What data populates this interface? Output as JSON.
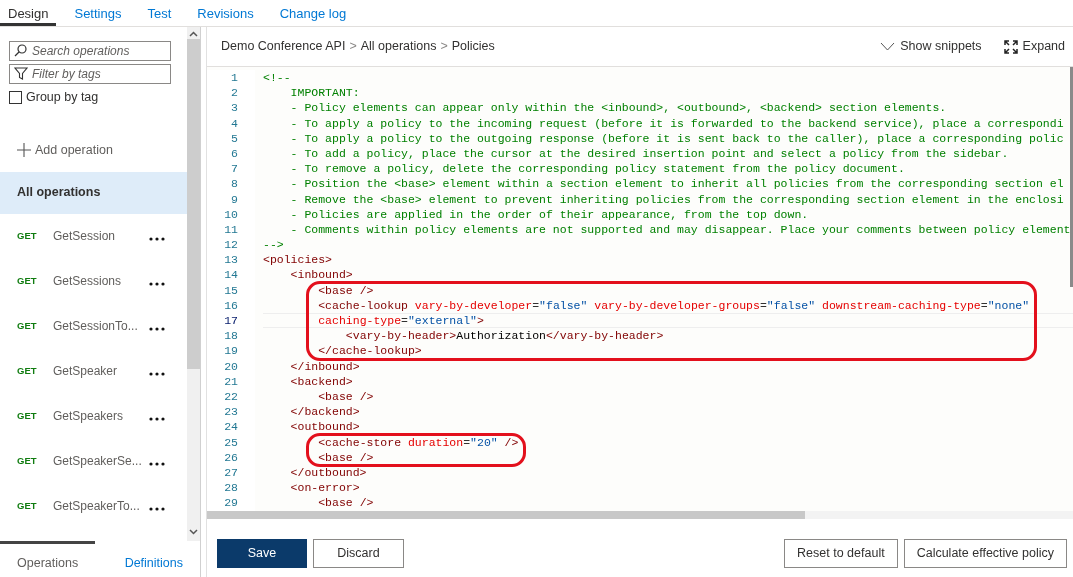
{
  "tabs": [
    {
      "label": "Design",
      "selected": true
    },
    {
      "label": "Settings",
      "selected": false
    },
    {
      "label": "Test",
      "selected": false
    },
    {
      "label": "Revisions",
      "selected": false
    },
    {
      "label": "Change log",
      "selected": false
    }
  ],
  "sidebar": {
    "search": {
      "placeholder": "Search operations"
    },
    "filter": {
      "placeholder": "Filter by tags"
    },
    "group_by_tag": {
      "label": "Group by tag",
      "checked": false
    },
    "add_operation": "Add operation",
    "all_operations": {
      "label": "All operations",
      "selected": true
    },
    "operations": [
      {
        "method": "GET",
        "name": "GetSession",
        "selected": false
      },
      {
        "method": "GET",
        "name": "GetSessions",
        "selected": false
      },
      {
        "method": "GET",
        "name": "GetSessionTo...",
        "selected": false
      },
      {
        "method": "GET",
        "name": "GetSpeaker",
        "selected": false
      },
      {
        "method": "GET",
        "name": "GetSpeakers",
        "selected": false
      },
      {
        "method": "GET",
        "name": "GetSpeakerSe...",
        "selected": false
      },
      {
        "method": "GET",
        "name": "GetSpeakerTo...",
        "selected": false
      }
    ],
    "bottom_tabs": [
      {
        "label": "Operations",
        "selected": true
      },
      {
        "label": "Definitions",
        "selected": false
      }
    ]
  },
  "breadcrumb": [
    {
      "kind": "link",
      "text": "Demo Conference API"
    },
    {
      "kind": "separator",
      "text": ">"
    },
    {
      "kind": "link",
      "text": "All operations"
    },
    {
      "kind": "separator",
      "text": ">"
    },
    {
      "kind": "current",
      "text": "Policies"
    }
  ],
  "toolbar": [
    {
      "kind": "snippets",
      "label": "Show snippets"
    },
    {
      "kind": "expand",
      "label": "Expand"
    }
  ],
  "editor": {
    "lines": [
      {
        "number": "1",
        "current": false,
        "circled": false,
        "tokens": [
          {
            "kind": "comment",
            "text": "<!--"
          }
        ]
      },
      {
        "number": "2",
        "current": false,
        "circled": false,
        "tokens": [
          {
            "kind": "comment",
            "text": "    IMPORTANT:"
          }
        ]
      },
      {
        "number": "3",
        "current": false,
        "circled": false,
        "tokens": [
          {
            "kind": "comment",
            "text": "    - Policy elements can appear only within the <inbound>, <outbound>, <backend> section elements."
          }
        ]
      },
      {
        "number": "4",
        "current": false,
        "circled": false,
        "tokens": [
          {
            "kind": "comment",
            "text": "    - To apply a policy to the incoming request (before it is forwarded to the backend service), place a correspondi"
          }
        ]
      },
      {
        "number": "5",
        "current": false,
        "circled": false,
        "tokens": [
          {
            "kind": "comment",
            "text": "    - To apply a policy to the outgoing response (before it is sent back to the caller), place a corresponding polic"
          }
        ]
      },
      {
        "number": "6",
        "current": false,
        "circled": false,
        "tokens": [
          {
            "kind": "comment",
            "text": "    - To add a policy, place the cursor at the desired insertion point and select a policy from the sidebar."
          }
        ]
      },
      {
        "number": "7",
        "current": false,
        "circled": false,
        "tokens": [
          {
            "kind": "comment",
            "text": "    - To remove a policy, delete the corresponding policy statement from the policy document."
          }
        ]
      },
      {
        "number": "8",
        "current": false,
        "circled": false,
        "tokens": [
          {
            "kind": "comment",
            "text": "    - Position the <base> element within a section element to inherit all policies from the corresponding section el"
          }
        ]
      },
      {
        "number": "9",
        "current": false,
        "circled": false,
        "tokens": [
          {
            "kind": "comment",
            "text": "    - Remove the <base> element to prevent inheriting policies from the corresponding section element in the enclosi"
          }
        ]
      },
      {
        "number": "10",
        "current": false,
        "circled": false,
        "tokens": [
          {
            "kind": "comment",
            "text": "    - Policies are applied in the order of their appearance, from the top down."
          }
        ]
      },
      {
        "number": "11",
        "current": false,
        "circled": false,
        "tokens": [
          {
            "kind": "comment",
            "text": "    - Comments within policy elements are not supported and may disappear. Place your comments between policy element"
          }
        ]
      },
      {
        "number": "12",
        "current": false,
        "circled": false,
        "tokens": [
          {
            "kind": "comment",
            "text": "-->"
          }
        ]
      },
      {
        "number": "13",
        "current": false,
        "circled": false,
        "tokens": [
          {
            "kind": "tag",
            "text": "<policies>"
          }
        ]
      },
      {
        "number": "14",
        "current": false,
        "circled": false,
        "tokens": [
          {
            "kind": "tag",
            "text": "    <inbound>"
          }
        ]
      },
      {
        "number": "15",
        "current": false,
        "circled": true,
        "tokens": [
          {
            "kind": "tag",
            "text": "        <base />"
          }
        ]
      },
      {
        "number": "16",
        "current": false,
        "circled": true,
        "tokens": [
          {
            "kind": "tag",
            "text": "        <cache-lookup"
          },
          {
            "kind": "attr",
            "text": " vary-by-developer"
          },
          {
            "kind": "punct",
            "text": "="
          },
          {
            "kind": "value",
            "text": "\"false\""
          },
          {
            "kind": "attr",
            "text": " vary-by-developer-groups"
          },
          {
            "kind": "punct",
            "text": "="
          },
          {
            "kind": "value",
            "text": "\"false\""
          },
          {
            "kind": "attr",
            "text": " downstream-caching-type"
          },
          {
            "kind": "punct",
            "text": "="
          },
          {
            "kind": "value",
            "text": "\"none\""
          }
        ]
      },
      {
        "number": "17",
        "current": true,
        "circled": true,
        "tokens": [
          {
            "kind": "attr",
            "text": "        caching-type"
          },
          {
            "kind": "punct",
            "text": "="
          },
          {
            "kind": "value",
            "text": "\"external\""
          },
          {
            "kind": "tag",
            "text": ">"
          }
        ]
      },
      {
        "number": "18",
        "current": false,
        "circled": true,
        "tokens": [
          {
            "kind": "tag",
            "text": "            <vary-by-header>"
          },
          {
            "kind": "text",
            "text": "Authorization"
          },
          {
            "kind": "tag",
            "text": "</vary-by-header>"
          }
        ]
      },
      {
        "number": "19",
        "current": false,
        "circled": true,
        "tokens": [
          {
            "kind": "tag",
            "text": "        </cache-lookup>"
          }
        ]
      },
      {
        "number": "20",
        "current": false,
        "circled": false,
        "tokens": [
          {
            "kind": "tag",
            "text": "    </inbound>"
          }
        ]
      },
      {
        "number": "21",
        "current": false,
        "circled": false,
        "tokens": [
          {
            "kind": "tag",
            "text": "    <backend>"
          }
        ]
      },
      {
        "number": "22",
        "current": false,
        "circled": false,
        "tokens": [
          {
            "kind": "tag",
            "text": "        <base />"
          }
        ]
      },
      {
        "number": "23",
        "current": false,
        "circled": false,
        "tokens": [
          {
            "kind": "tag",
            "text": "    </backend>"
          }
        ]
      },
      {
        "number": "24",
        "current": false,
        "circled": false,
        "tokens": [
          {
            "kind": "tag",
            "text": "    <outbound>"
          }
        ]
      },
      {
        "number": "25",
        "current": false,
        "circled": true,
        "tokens": [
          {
            "kind": "tag",
            "text": "        <cache-store"
          },
          {
            "kind": "attr",
            "text": " duration"
          },
          {
            "kind": "punct",
            "text": "="
          },
          {
            "kind": "value",
            "text": "\"20\""
          },
          {
            "kind": "tag",
            "text": " />"
          }
        ]
      },
      {
        "number": "26",
        "current": false,
        "circled": true,
        "tokens": [
          {
            "kind": "tag",
            "text": "        <base />"
          }
        ]
      },
      {
        "number": "27",
        "current": false,
        "circled": false,
        "tokens": [
          {
            "kind": "tag",
            "text": "    </outbound>"
          }
        ]
      },
      {
        "number": "28",
        "current": false,
        "circled": false,
        "tokens": [
          {
            "kind": "tag",
            "text": "    <on-error>"
          }
        ]
      },
      {
        "number": "29",
        "current": false,
        "circled": false,
        "tokens": [
          {
            "kind": "tag",
            "text": "        <base />"
          }
        ]
      }
    ]
  },
  "footer": {
    "left_buttons": [
      {
        "kind": "primary",
        "label": "Save"
      },
      {
        "kind": "default",
        "label": "Discard"
      }
    ],
    "right_buttons": [
      {
        "kind": "default",
        "label": "Reset to default"
      },
      {
        "kind": "default",
        "label": "Calculate effective policy"
      }
    ]
  }
}
